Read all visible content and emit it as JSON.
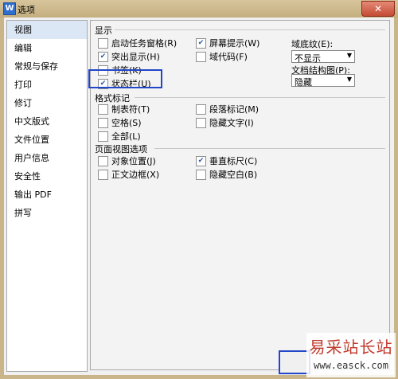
{
  "window": {
    "title": "选项",
    "app_icon": "W",
    "close_glyph": "✕"
  },
  "sidebar": {
    "items": [
      {
        "label": "视图",
        "selected": true
      },
      {
        "label": "编辑"
      },
      {
        "label": "常规与保存"
      },
      {
        "label": "打印"
      },
      {
        "label": "修订"
      },
      {
        "label": "中文版式"
      },
      {
        "label": "文件位置"
      },
      {
        "label": "用户信息"
      },
      {
        "label": "安全性"
      },
      {
        "label": "输出 PDF"
      },
      {
        "label": "拼写"
      }
    ]
  },
  "display": {
    "title": "显示",
    "startup_pane": {
      "label": "启动任务窗格(R)",
      "checked": false
    },
    "highlight": {
      "label": "突出显示(H)",
      "checked": true
    },
    "bookmarks": {
      "label": "书签(K)",
      "checked": false
    },
    "status_bar": {
      "label": "状态栏(U)",
      "checked": true
    },
    "screen_tips": {
      "label": "屏幕提示(W)",
      "checked": true
    },
    "field_codes": {
      "label": "域代码(F)",
      "checked": false
    },
    "field_shading": {
      "label": "域底纹(E):",
      "value": "不显示"
    },
    "doc_map": {
      "label": "文档结构图(P):",
      "value": "隐藏"
    }
  },
  "format_marks": {
    "title": "格式标记",
    "tab": {
      "label": "制表符(T)",
      "checked": false
    },
    "spaces": {
      "label": "空格(S)",
      "checked": false
    },
    "all": {
      "label": "全部(L)",
      "checked": false
    },
    "paragraph": {
      "label": "段落标记(M)",
      "checked": false
    },
    "hidden_text": {
      "label": "隐藏文字(I)",
      "checked": false
    }
  },
  "page_view": {
    "title": "页面视图选项",
    "object_position": {
      "label": "对象位置(J)",
      "checked": false
    },
    "text_boundaries": {
      "label": "正文边框(X)",
      "checked": false
    },
    "vertical_ruler": {
      "label": "垂直标尺(C)",
      "checked": true
    },
    "hide_whitespace": {
      "label": "隐藏空白(B)",
      "checked": false
    }
  },
  "watermark": {
    "title": "易采站长站",
    "url": "www.easck.com"
  },
  "colors": {
    "highlight_box": "#2246c8",
    "frame": "#c9b589",
    "selected": "#dce7f6"
  }
}
